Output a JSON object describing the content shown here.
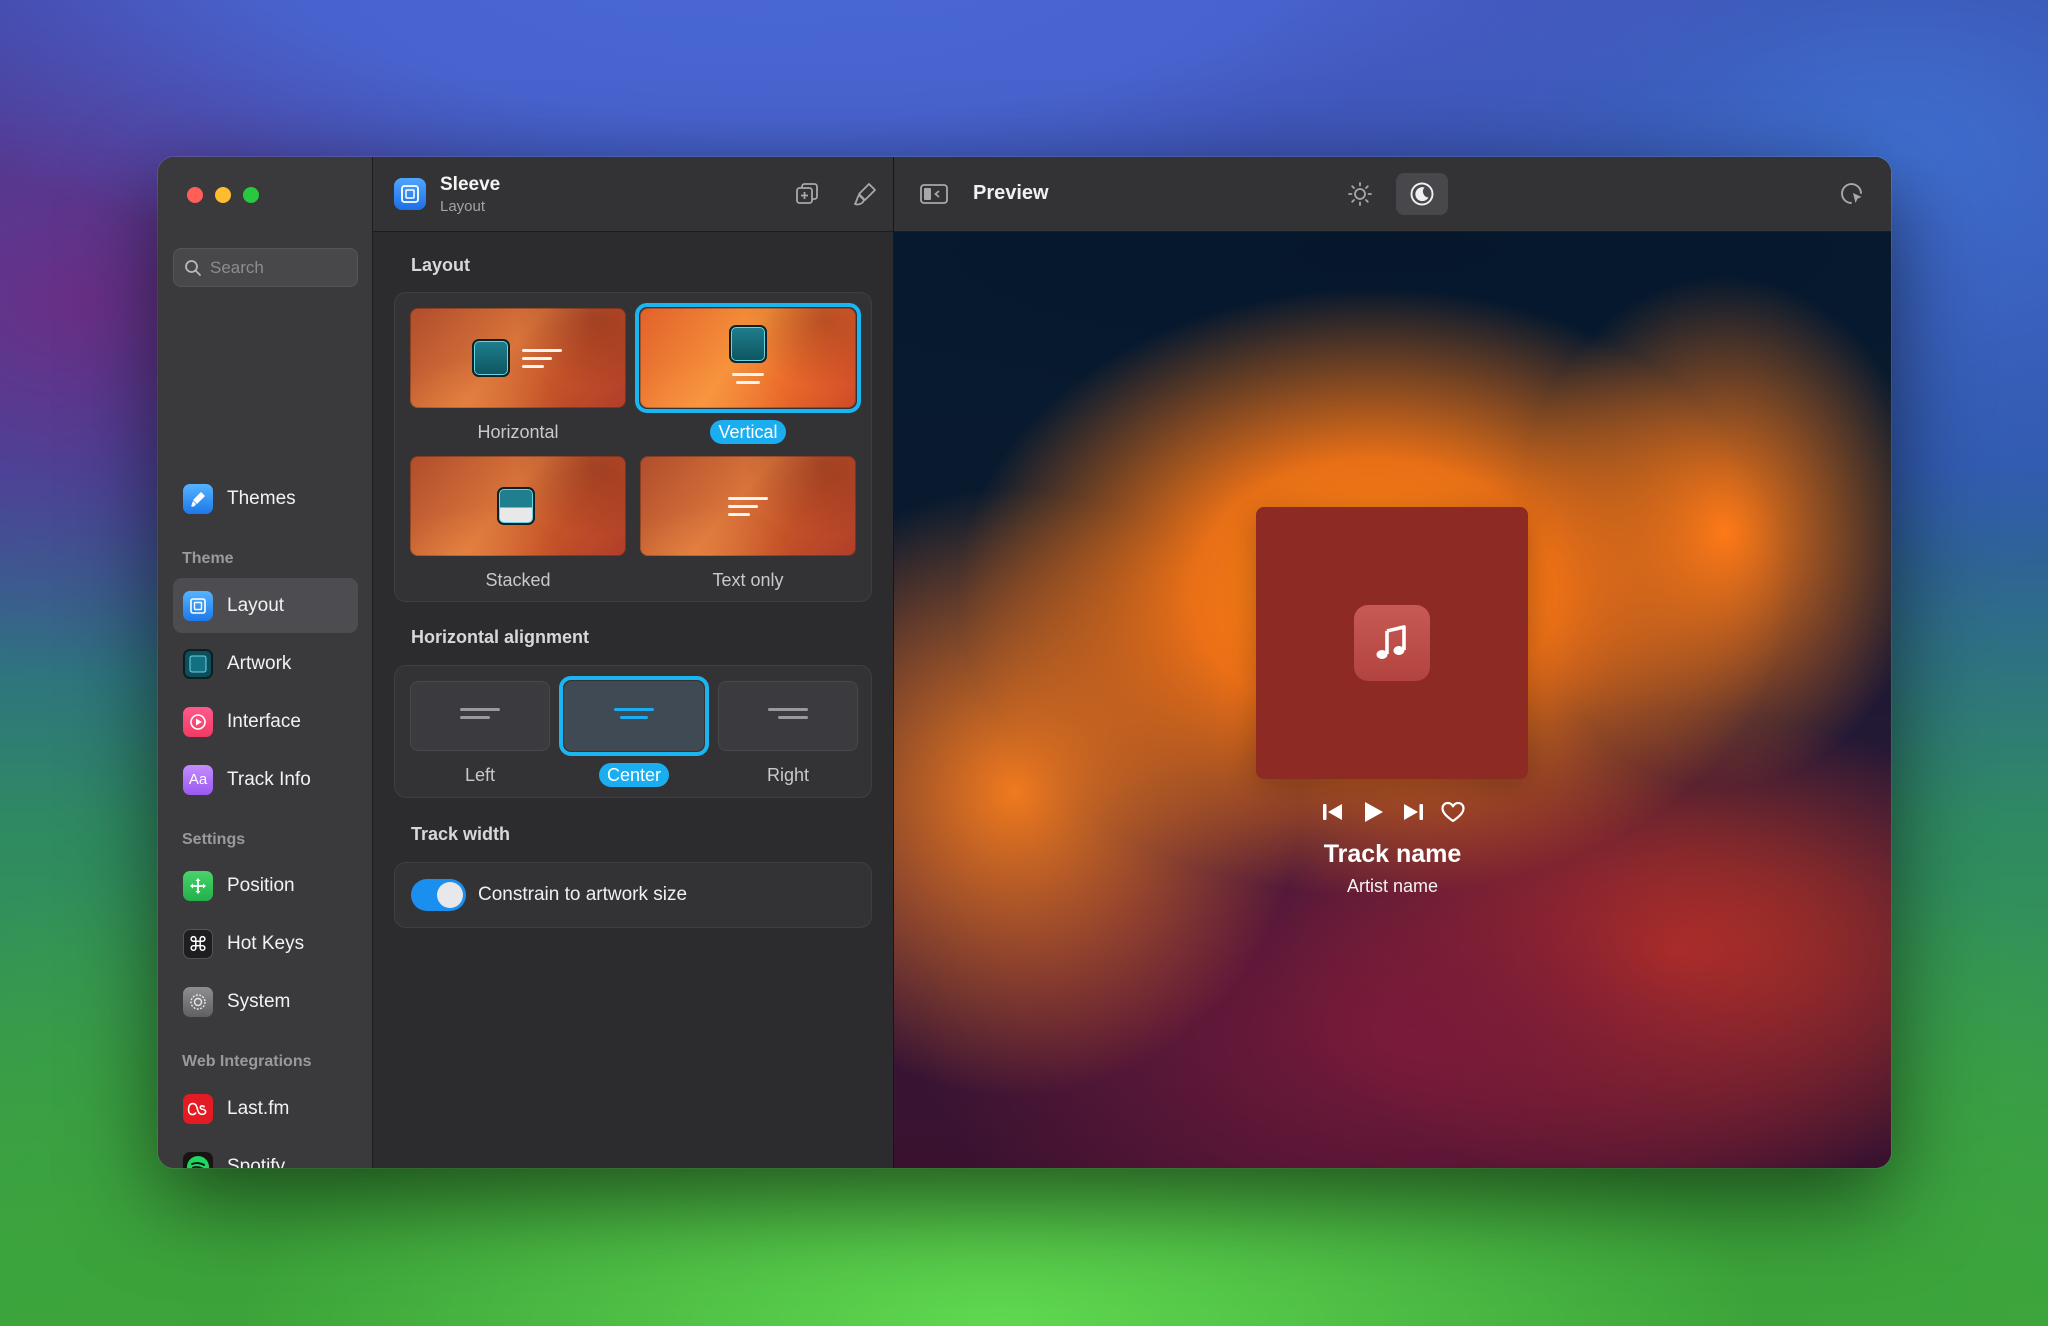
{
  "window": {
    "sidebar": {
      "search_placeholder": "Search",
      "top_items": [
        {
          "label": "Themes",
          "icon": "brush-icon"
        }
      ],
      "sections": [
        {
          "label": "Theme",
          "items": [
            {
              "label": "Layout",
              "icon": "layout-icon",
              "active": true
            },
            {
              "label": "Artwork",
              "icon": "artwork-icon"
            },
            {
              "label": "Interface",
              "icon": "interface-icon"
            },
            {
              "label": "Track Info",
              "icon": "text-icon",
              "icon_text": "Aa"
            }
          ]
        },
        {
          "label": "Settings",
          "items": [
            {
              "label": "Position",
              "icon": "move-icon"
            },
            {
              "label": "Hot Keys",
              "icon": "command-icon"
            },
            {
              "label": "System",
              "icon": "gear-icon"
            }
          ]
        },
        {
          "label": "Web Integrations",
          "items": [
            {
              "label": "Last.fm",
              "icon": "lastfm-icon"
            },
            {
              "label": "Spotify",
              "icon": "spotify-icon"
            }
          ]
        }
      ]
    },
    "middle": {
      "app_title": "Sleeve",
      "app_subtitle": "Layout",
      "layout_group_label": "Layout",
      "layout_options": [
        {
          "label": "Horizontal",
          "selected": false
        },
        {
          "label": "Vertical",
          "selected": true
        },
        {
          "label": "Stacked",
          "selected": false
        },
        {
          "label": "Text only",
          "selected": false
        }
      ],
      "alignment_group_label": "Horizontal alignment",
      "alignment_options": [
        {
          "label": "Left",
          "selected": false
        },
        {
          "label": "Center",
          "selected": true
        },
        {
          "label": "Right",
          "selected": false
        }
      ],
      "track_width_label": "Track width",
      "constrain_label": "Constrain to artwork size",
      "constrain_on": true
    },
    "preview": {
      "title": "Preview",
      "track_name": "Track name",
      "artist_name": "Artist name"
    }
  },
  "colors": {
    "accent": "#1aaef0",
    "toggle_on": "#1a8ff0"
  }
}
